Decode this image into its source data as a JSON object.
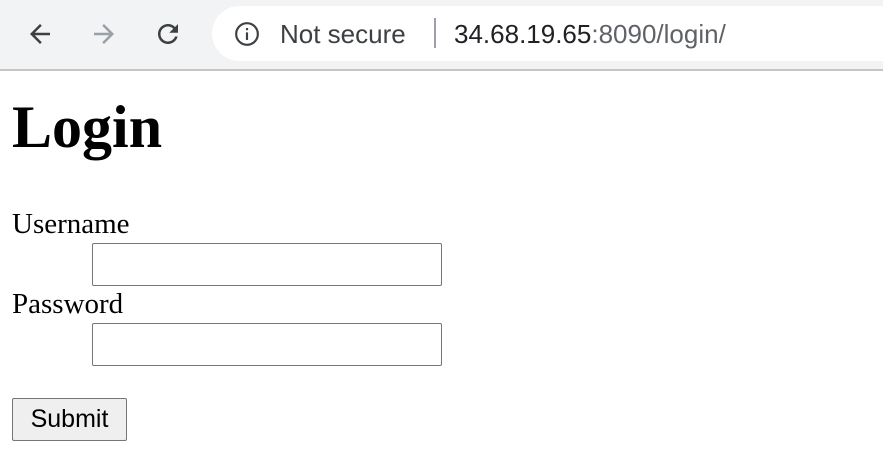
{
  "browser": {
    "back_icon": "arrow-left-icon",
    "forward_icon": "arrow-right-icon",
    "reload_icon": "reload-icon",
    "security_icon": "info-circle-icon",
    "security_label": "Not secure",
    "url_host": "34.68.19.65",
    "url_rest": ":8090/login/"
  },
  "page": {
    "title": "Login",
    "form": {
      "username_label": "Username",
      "username_value": "",
      "password_label": "Password",
      "password_value": "",
      "submit_label": "Submit"
    }
  }
}
